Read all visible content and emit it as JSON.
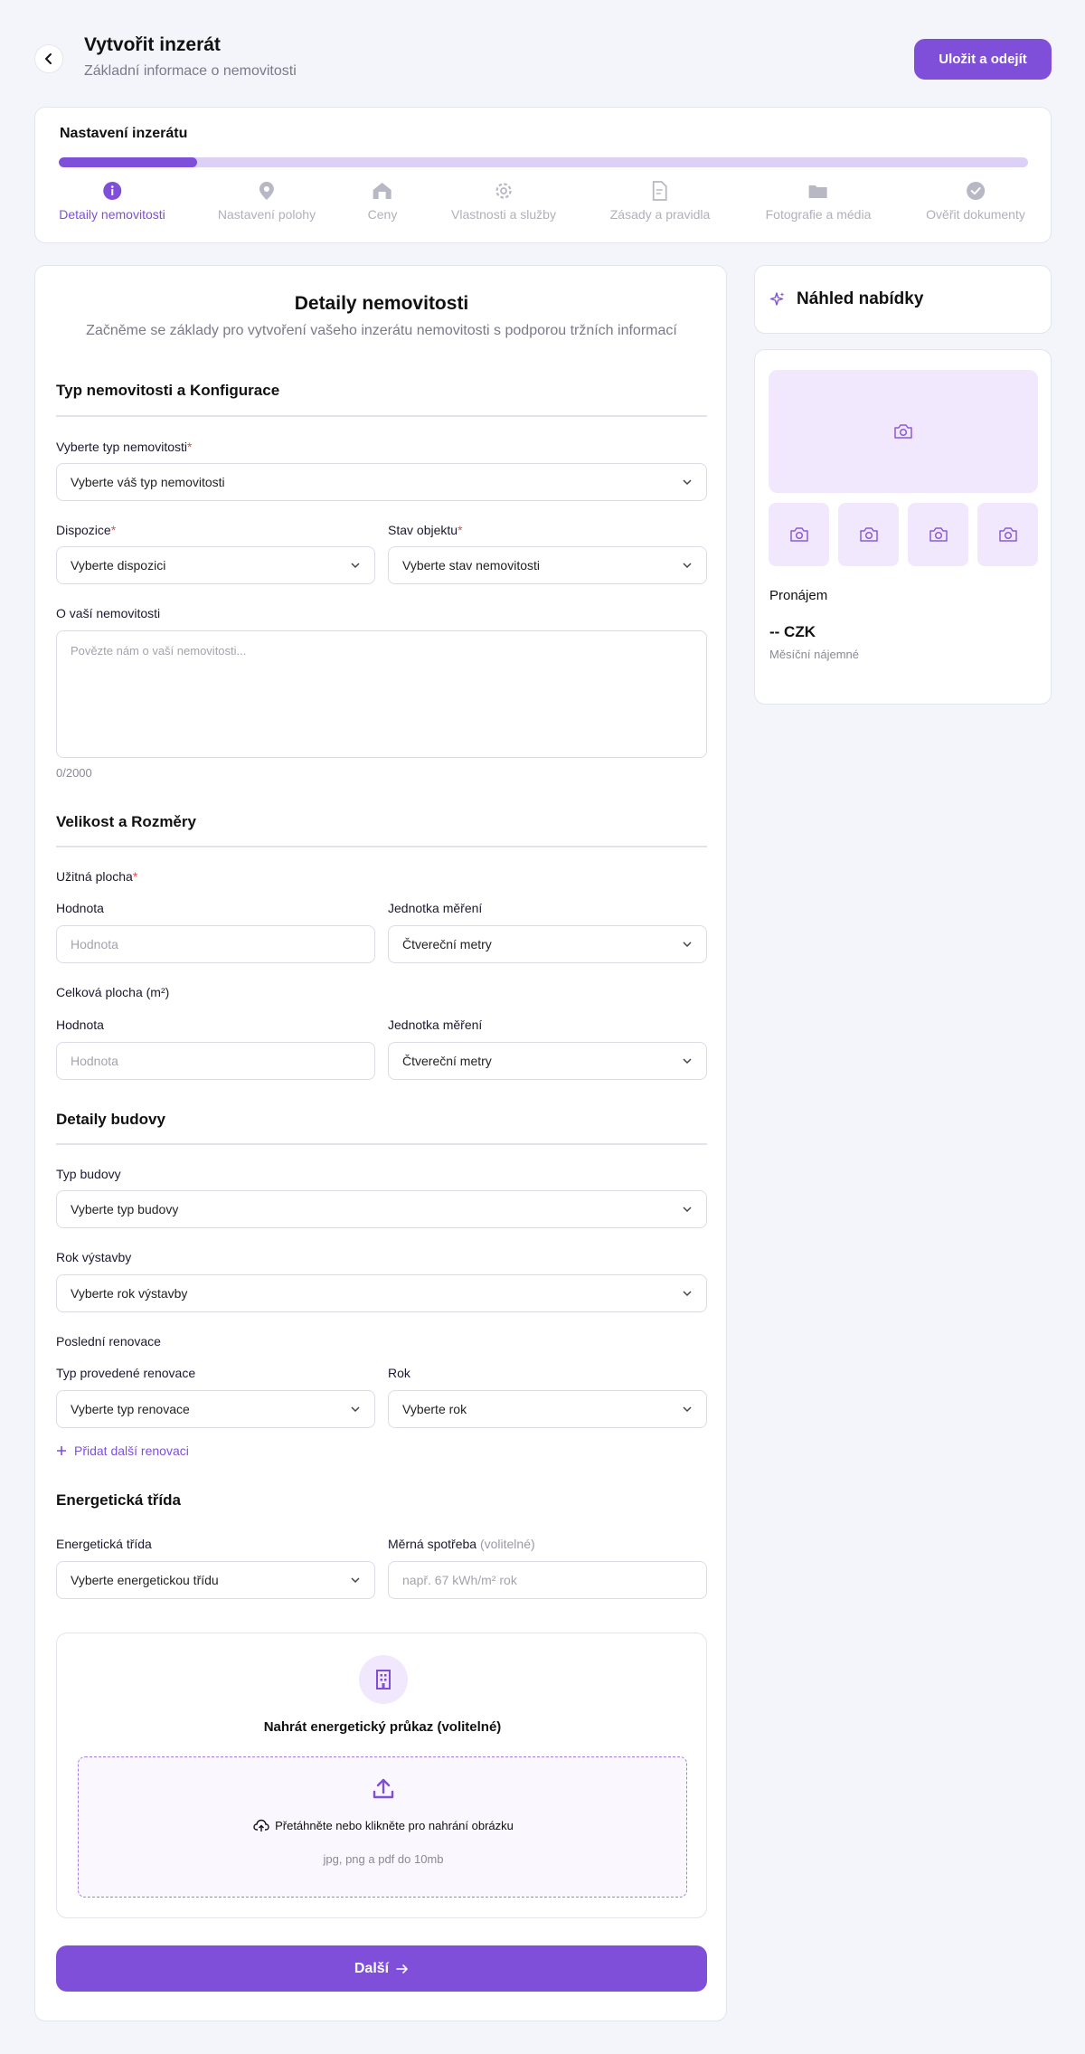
{
  "header": {
    "title": "Vytvořit inzerát",
    "subtitle": "Základní informace o nemovitosti",
    "save_label": "Uložit a odejít"
  },
  "stepper": {
    "title": "Nastavení inzerátu",
    "progress": 0.143,
    "steps": [
      {
        "label": "Detaily nemovitosti",
        "icon": "info-icon",
        "active": true
      },
      {
        "label": "Nastavení polohy",
        "icon": "location-pin-icon",
        "active": false
      },
      {
        "label": "Ceny",
        "icon": "house-price-icon",
        "active": false
      },
      {
        "label": "Vlastnosti a služby",
        "icon": "gear-icon",
        "active": false
      },
      {
        "label": "Zásady a pravidla",
        "icon": "document-icon",
        "active": false
      },
      {
        "label": "Fotografie a média",
        "icon": "folder-icon",
        "active": false
      },
      {
        "label": "Ověřit dokumenty",
        "icon": "check-circle-icon",
        "active": false
      }
    ]
  },
  "form": {
    "title": "Detaily nemovitosti",
    "subtitle": "Začněme se základy pro vytvoření vašeho inzerátu nemovitosti s podporou tržních informací",
    "section_type": "Typ nemovitosti a Konfigurace",
    "property_type": {
      "label": "Vyberte typ nemovitosti",
      "value": "Vyberte váš typ nemovitosti"
    },
    "disposition": {
      "label": "Dispozice",
      "value": "Vyberte dispozici"
    },
    "condition": {
      "label": "Stav objektu",
      "value": "Vyberte stav nemovitosti"
    },
    "about": {
      "label": "O vaší nemovitosti",
      "placeholder": "Povězte nám o vaší nemovitosti...",
      "counter": "0/2000"
    },
    "section_size": "Velikost a Rozměry",
    "usable_area": {
      "label": "Užitná plocha",
      "value_label": "Hodnota",
      "value_placeholder": "Hodnota",
      "unit_label": "Jednotka měření",
      "unit_value": "Čtvereční metry"
    },
    "total_area": {
      "label": "Celková plocha (m²)",
      "value_label": "Hodnota",
      "value_placeholder": "Hodnota",
      "unit_label": "Jednotka měření",
      "unit_value": "Čtvereční metry"
    },
    "section_building": "Detaily budovy",
    "building_type": {
      "label": "Typ budovy",
      "value": "Vyberte typ budovy"
    },
    "build_year": {
      "label": "Rok výstavby",
      "value": "Vyberte rok výstavby"
    },
    "renovation": {
      "label": "Poslední renovace",
      "type_label": "Typ provedené renovace",
      "type_value": "Vyberte typ renovace",
      "year_label": "Rok",
      "year_value": "Vyberte rok"
    },
    "add_renovation": "Přidat další renovaci",
    "section_energy": "Energetická třída",
    "energy_class": {
      "label": "Energetická třída",
      "value": "Vyberte energetickou třídu"
    },
    "consumption": {
      "label": "Měrná spotřeba",
      "optional": "(volitelné)",
      "placeholder": "např. 67 kWh/m² rok"
    },
    "upload": {
      "title": "Nahrát energetický průkaz (volitelné)",
      "text": "Přetáhněte nebo klikněte pro nahrání obrázku",
      "hint": "jpg, png a pdf do 10mb"
    },
    "next_label": "Další"
  },
  "preview": {
    "title": "Náhled nabídky",
    "type": "Pronájem",
    "price": "-- CZK",
    "price_note": "Měsíční nájemné"
  },
  "colors": {
    "accent": "#7f4fd9",
    "accent_light": "#f1e8fd",
    "required": "#e05050"
  }
}
